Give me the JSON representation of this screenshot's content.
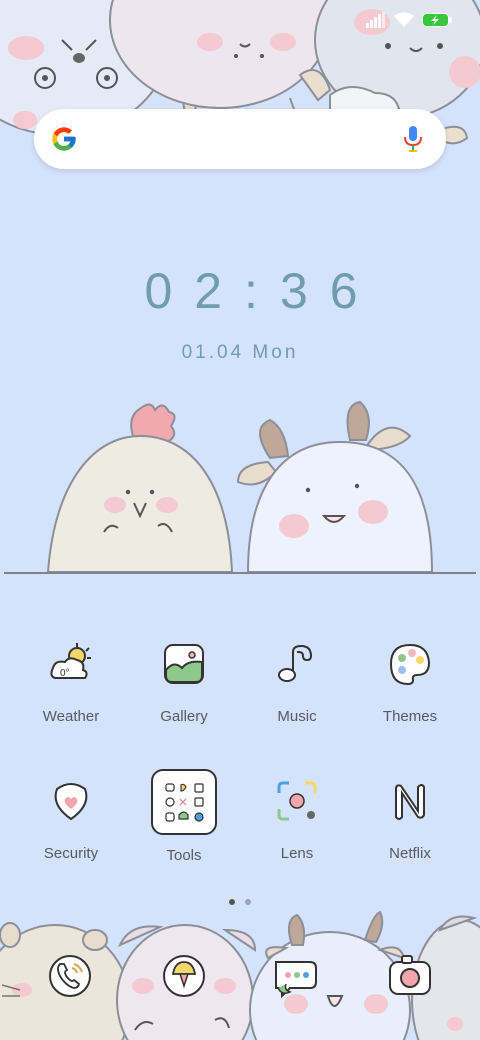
{
  "status_bar": {
    "signal_icon": "signal-icon",
    "wifi_icon": "wifi-icon",
    "battery_icon": "battery-charging-icon",
    "battery_color": "#3cc63c"
  },
  "search_bar": {
    "logo_icon": "google-logo-icon",
    "mic_icon": "microphone-icon"
  },
  "clock": {
    "time": "02:36",
    "date": "01.04 Mon"
  },
  "apps": [
    {
      "label": "Weather",
      "icon": "weather-icon"
    },
    {
      "label": "Gallery",
      "icon": "gallery-icon"
    },
    {
      "label": "Music",
      "icon": "music-icon"
    },
    {
      "label": "Themes",
      "icon": "themes-icon"
    },
    {
      "label": "Security",
      "icon": "security-icon"
    },
    {
      "label": "Tools",
      "icon": "tools-folder-icon"
    },
    {
      "label": "Lens",
      "icon": "lens-icon"
    },
    {
      "label": "Netflix",
      "icon": "netflix-icon"
    }
  ],
  "weather_temp": "0°",
  "page_indicator": {
    "count": 2,
    "active": 0
  },
  "dock": [
    {
      "icon": "phone-icon"
    },
    {
      "icon": "browser-icon"
    },
    {
      "icon": "messages-icon"
    },
    {
      "icon": "camera-icon"
    }
  ],
  "colors": {
    "background": "#d5e2fb",
    "clock_text": "#6d9dae",
    "label_text": "#555b63"
  }
}
